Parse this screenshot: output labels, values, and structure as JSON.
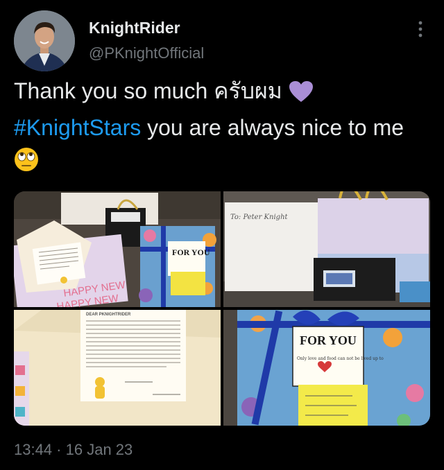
{
  "author": {
    "name": "KnightRider",
    "handle": "@PKnightOfficial"
  },
  "tweet": {
    "text_part1": "Thank you so much ครับผม ",
    "heart_emoji": "purple-heart",
    "hashtag": "#KnightStars",
    "text_part2": " you are always nice to me ",
    "face_emoji": "face-with-rolling-eyes"
  },
  "media": {
    "photos": [
      {
        "name": "letter-and-gift-bags"
      },
      {
        "name": "envelope-and-gift-bag"
      },
      {
        "name": "handwritten-letter"
      },
      {
        "name": "for-you-gift-box"
      }
    ],
    "card_text": {
      "for_you": "FOR YOU",
      "card_subtext": "Only love and food can not be lived up to",
      "envelope_label": "To: Peter Knight",
      "happy_new_year": "HAPPY NEW",
      "letter_heading": "DEAR PKNIGHTRIDER"
    }
  },
  "meta": {
    "time": "13:44",
    "separator": " · ",
    "date": "16 Jan 23"
  },
  "colors": {
    "background": "#000000",
    "text": "#e7e9ea",
    "secondary": "#71767b",
    "link": "#1d9bf0"
  }
}
